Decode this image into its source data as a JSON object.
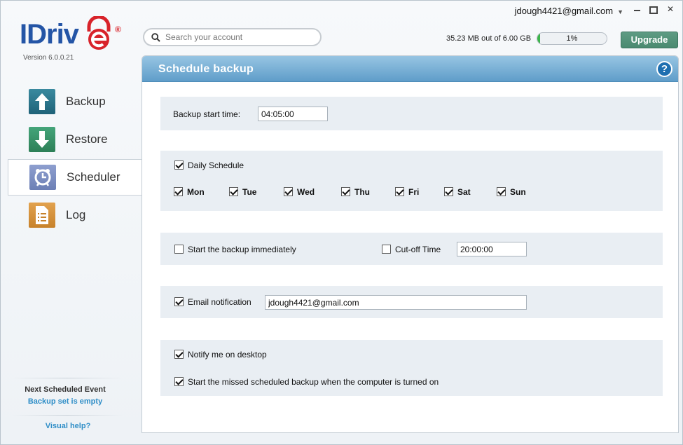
{
  "header": {
    "account_email": "jdough4421@gmail.com",
    "version_label": "Version  6.0.0.21",
    "logo_text": "IDriv",
    "logo_reg": "®",
    "search_placeholder": "Search your account",
    "storage_text": "35.23 MB out of 6.00 GB",
    "storage_percent": 1,
    "storage_percent_label": "1%",
    "upgrade_label": "Upgrade"
  },
  "sidebar": {
    "items": [
      {
        "label": "Backup",
        "icon": "upload-arrow-icon",
        "active": false
      },
      {
        "label": "Restore",
        "icon": "download-arrow-icon",
        "active": false
      },
      {
        "label": "Scheduler",
        "icon": "alarm-clock-icon",
        "active": true
      },
      {
        "label": "Log",
        "icon": "document-list-icon",
        "active": false
      }
    ],
    "next_event_title": "Next Scheduled Event",
    "next_event_value": "Backup set is empty",
    "visual_help": "Visual help?"
  },
  "panel": {
    "title": "Schedule  backup",
    "help_label": "?",
    "start_time_label": "Backup start time:",
    "start_time_value": "04:05:00",
    "daily_schedule_label": "Daily Schedule",
    "daily_schedule_checked": true,
    "days": [
      {
        "label": "Mon",
        "checked": true
      },
      {
        "label": "Tue",
        "checked": true
      },
      {
        "label": "Wed",
        "checked": true
      },
      {
        "label": "Thu",
        "checked": true
      },
      {
        "label": "Fri",
        "checked": true
      },
      {
        "label": "Sat",
        "checked": true
      },
      {
        "label": "Sun",
        "checked": true
      }
    ],
    "start_immediately_label": "Start the backup immediately",
    "start_immediately_checked": false,
    "cutoff_label": "Cut-off Time",
    "cutoff_checked": false,
    "cutoff_value": "20:00:00",
    "email_label": "Email notification",
    "email_checked": true,
    "email_value": "jdough4421@gmail.com",
    "notify_desktop_label": "Notify me on desktop",
    "notify_desktop_checked": true,
    "missed_backup_label": "Start the missed scheduled backup when the computer is turned on",
    "missed_backup_checked": true
  },
  "colors": {
    "accent": "#5f9dc9",
    "upgrade": "#4a8a70",
    "link": "#2f8ec7",
    "progress": "#3cb54a"
  }
}
